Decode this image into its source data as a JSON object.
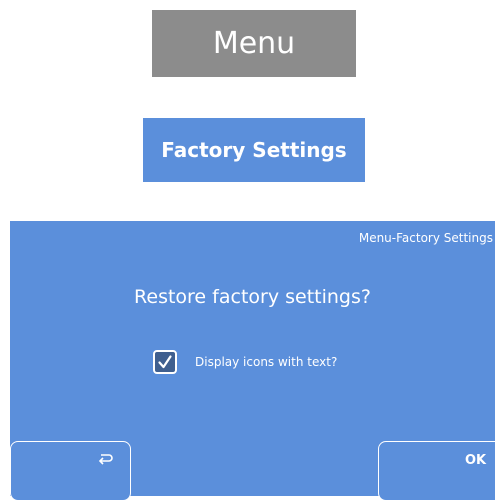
{
  "menu": {
    "label": "Menu",
    "color": "#8c8c8c"
  },
  "factory_settings": {
    "label": "Factory Settings",
    "color": "#5b8fdb"
  },
  "dialog": {
    "title": "Menu-Factory Settings",
    "question": "Restore factory settings?",
    "checkbox": {
      "label": "Display icons with text?",
      "checked": true
    },
    "back_icon": "return-icon",
    "ok_label": "OK",
    "color": "#5b8fdb"
  }
}
